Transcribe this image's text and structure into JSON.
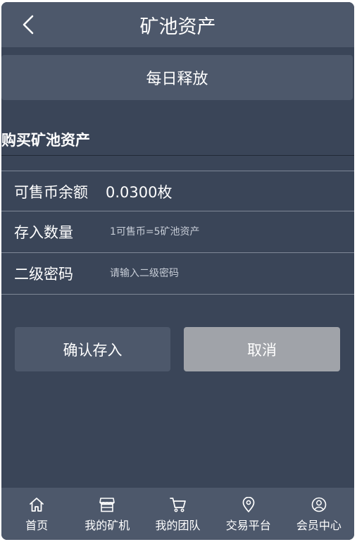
{
  "header": {
    "title": "矿池资产",
    "back_icon": "chevron-left-icon"
  },
  "sub_nav": {
    "label": "每日释放"
  },
  "section": {
    "title": "购买矿池资产"
  },
  "form": {
    "balance_label": "可售币余额",
    "balance_value": "0.0300枚",
    "quantity_label": "存入数量",
    "quantity_placeholder": "1可售币=5矿池资产",
    "quantity_value": "",
    "password_label": "二级密码",
    "password_placeholder": "请输入二级密码",
    "password_value": ""
  },
  "buttons": {
    "confirm_label": "确认存入",
    "cancel_label": "取消"
  },
  "tabbar": {
    "items": [
      {
        "label": "首页",
        "icon": "home-icon"
      },
      {
        "label": "我的矿机",
        "icon": "store-icon"
      },
      {
        "label": "我的团队",
        "icon": "cart-icon"
      },
      {
        "label": "交易平台",
        "icon": "location-pin-icon"
      },
      {
        "label": "会员中心",
        "icon": "user-icon"
      }
    ]
  },
  "colors": {
    "background": "#3a4558",
    "bar": "#4d586b",
    "cancel_button": "#a0a3a9",
    "text": "#ffffff"
  }
}
